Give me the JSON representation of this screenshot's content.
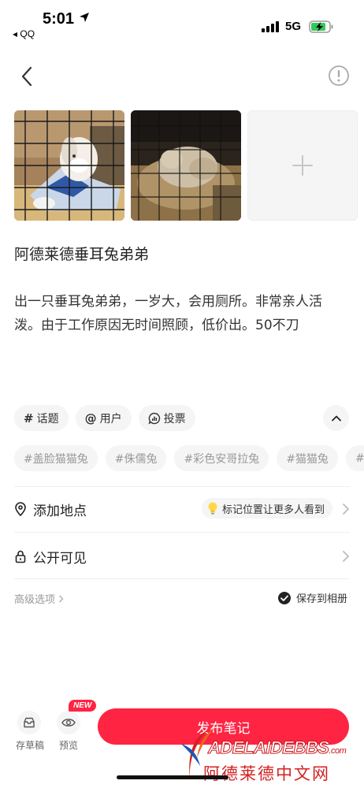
{
  "status_bar": {
    "time": "5:01",
    "back_app": "◂ QQ",
    "network": "5G"
  },
  "note": {
    "title": "阿德莱德垂耳兔弟弟",
    "body": "出一只垂耳兔弟弟，一岁大，会用厕所。非常亲人活泼。由于工作原因无时间照顾，低价出。50不刀"
  },
  "chips": [
    {
      "icon": "#",
      "label": "话题"
    },
    {
      "icon": "@",
      "label": "用户"
    },
    {
      "icon": "",
      "label": "投票"
    }
  ],
  "suggested_tags": [
    "#盖脸猫猫兔",
    "#侏儒兔",
    "#彩色安哥拉兔",
    "#猫猫兔",
    "#"
  ],
  "location_row": {
    "label": "添加地点",
    "hint": "标记位置让更多人看到"
  },
  "visibility_row": {
    "label": "公开可见"
  },
  "advanced": {
    "label": "高级选项"
  },
  "save_to_album": {
    "label": "保存到相册"
  },
  "bottom_bar": {
    "drafts_label": "存草稿",
    "preview_label": "预览",
    "new_badge": "NEW",
    "publish_label": "发布笔记"
  },
  "watermark": {
    "en": "ADELAIDEBBS",
    "com": ".com",
    "cn": "阿德莱德中文网"
  },
  "colors": {
    "accent": "#ff2442",
    "chip_bg": "#f5f5f5",
    "watermark_red": "#c9141b"
  }
}
